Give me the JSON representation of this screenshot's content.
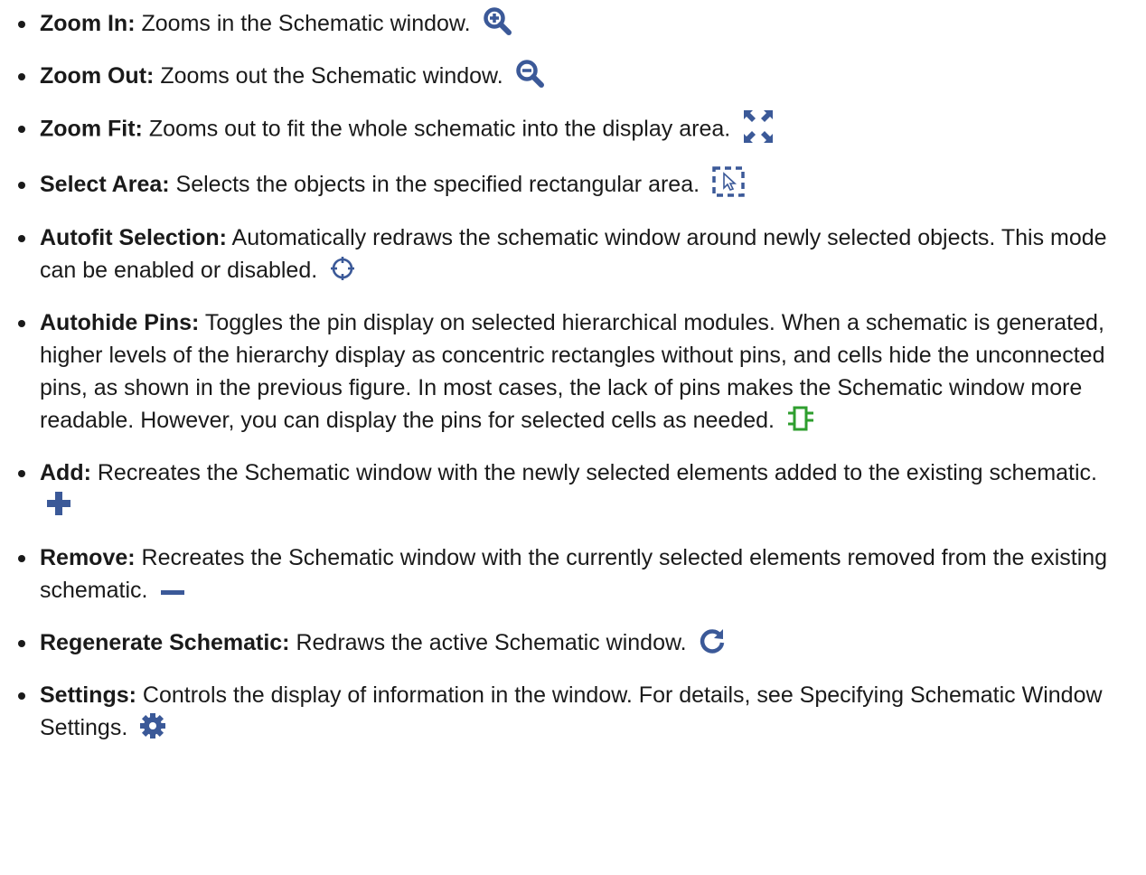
{
  "colors": {
    "icon_blue": "#3b5998",
    "icon_green": "#2e9e2e",
    "text": "#1a1a1a"
  },
  "items": [
    {
      "term": "Zoom In:",
      "description": "Zooms in the Schematic window.",
      "icon": "zoom-in-icon"
    },
    {
      "term": "Zoom Out:",
      "description": "Zooms out the Schematic window.",
      "icon": "zoom-out-icon"
    },
    {
      "term": "Zoom Fit:",
      "description": "Zooms out to fit the whole schematic into the display area.",
      "icon": "zoom-fit-icon"
    },
    {
      "term": "Select Area:",
      "description": "Selects the objects in the specified rectangular area.",
      "icon": "select-area-icon"
    },
    {
      "term": "Autofit Selection:",
      "description": "Automatically redraws the schematic window around newly selected objects. This mode can be enabled or disabled.",
      "icon": "autofit-selection-icon"
    },
    {
      "term": "Autohide Pins:",
      "description": "Toggles the pin display on selected hierarchical modules. When a schematic is generated, higher levels of the hierarchy display as concentric rectangles without pins, and cells hide the unconnected pins, as shown in the previous figure. In most cases, the lack of pins makes the Schematic window more readable. However, you can display the pins for selected cells as needed.",
      "icon": "autohide-pins-icon"
    },
    {
      "term": "Add:",
      "description": "Recreates the Schematic window with the newly selected elements added to the existing schematic.",
      "icon": "add-icon"
    },
    {
      "term": "Remove:",
      "description": "Recreates the Schematic window with the currently selected elements removed from the existing schematic.",
      "icon": "remove-icon"
    },
    {
      "term": "Regenerate Schematic:",
      "description": "Redraws the active Schematic window.",
      "icon": "regenerate-icon"
    },
    {
      "term": "Settings:",
      "description": "Controls the display of information in the window. For details, see Specifying Schematic Window Settings.",
      "icon": "settings-gear-icon"
    }
  ]
}
